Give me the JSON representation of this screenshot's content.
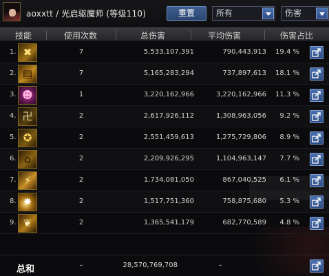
{
  "header": {
    "character_label": "aoxxtt / 光启驱魔师 (等级110)",
    "reset_button": "重置",
    "filter_select": "所有",
    "sort_select": "伤害"
  },
  "columns": [
    "技能",
    "使用次数",
    "总伤害",
    "平均伤害",
    "伤害占比"
  ],
  "rows": [
    {
      "rank": "1.",
      "icon": "cross-x-skill-icon",
      "uses": "7",
      "total": "5,533,107,391",
      "avg": "790,443,913",
      "pct": "19.4 %"
    },
    {
      "rank": "2.",
      "icon": "talisman-scroll-skill-icon",
      "uses": "7",
      "total": "5,165,283,294",
      "avg": "737,897,613",
      "pct": "18.1 %"
    },
    {
      "rank": "3.",
      "icon": "demon-face-skill-icon",
      "uses": "1",
      "total": "3,220,162,966",
      "avg": "3,220,162,966",
      "pct": "11.3 %"
    },
    {
      "rank": "4.",
      "icon": "rune-glyph-skill-icon",
      "uses": "2",
      "total": "2,617,926,112",
      "avg": "1,308,963,056",
      "pct": "9.2 %"
    },
    {
      "rank": "5.",
      "icon": "pentagram-skill-icon",
      "uses": "2",
      "total": "2,551,459,613",
      "avg": "1,275,729,806",
      "pct": "8.9 %"
    },
    {
      "rank": "6.",
      "icon": "seal-character-skill-icon",
      "uses": "2",
      "total": "2,209,926,295",
      "avg": "1,104,963,147",
      "pct": "7.7 %"
    },
    {
      "rank": "7.",
      "icon": "flame-slash-skill-icon",
      "uses": "2",
      "total": "1,734,081,050",
      "avg": "867,040,525",
      "pct": "6.1 %"
    },
    {
      "rank": "8.",
      "icon": "burst-strike-skill-icon",
      "uses": "2",
      "total": "1,517,751,360",
      "avg": "758,875,680",
      "pct": "5.3 %"
    },
    {
      "rank": "9.",
      "icon": "phoenix-skill-icon",
      "uses": "2",
      "total": "1,365,541,179",
      "avg": "682,770,589",
      "pct": "4.8 %"
    }
  ],
  "total": {
    "label": "总和",
    "uses": "–",
    "total": "28,570,769,708",
    "avg": "–"
  },
  "colors": {
    "accent_button": "#3f5f8f",
    "icon_border": "#8a6a20",
    "background": "#0b0b0d"
  }
}
